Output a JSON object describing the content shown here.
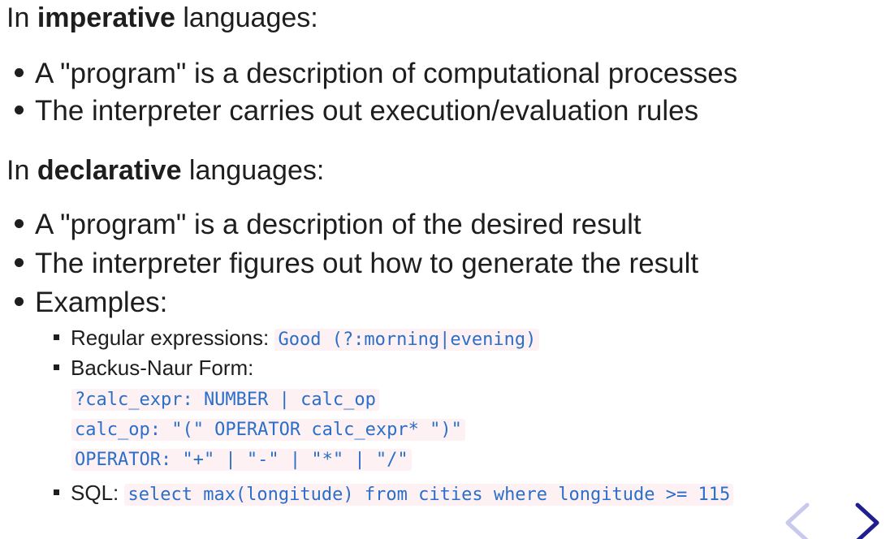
{
  "section1": {
    "prefix": "In ",
    "keyword": "imperative",
    "suffix": " languages:",
    "bullets": [
      "A \"program\" is a description of computational processes",
      "The interpreter carries out execution/evaluation rules"
    ]
  },
  "section2": {
    "prefix": "In ",
    "keyword": "declarative",
    "suffix": " languages:",
    "bullets": [
      "A \"program\" is a description of the desired result",
      "The interpreter figures out how to generate the result",
      "Examples:"
    ],
    "examples": {
      "regex_label": "Regular expressions: ",
      "regex_code": "Good (?:morning|evening)",
      "bnf_label": "Backus-Naur Form:",
      "bnf_lines": [
        "?calc_expr: NUMBER | calc_op",
        "calc_op: \"(\" OPERATOR calc_expr* \")\"",
        "OPERATOR: \"+\" | \"-\" | \"*\" | \"/\""
      ],
      "sql_label": "SQL: ",
      "sql_code": "select max(longitude) from cities where longitude >= 115"
    }
  },
  "nav": {
    "prev_icon": "chevron-left-icon",
    "next_icon": "chevron-right-icon",
    "prev_color": "#c9c8ee",
    "next_color": "#1f1f8f"
  }
}
